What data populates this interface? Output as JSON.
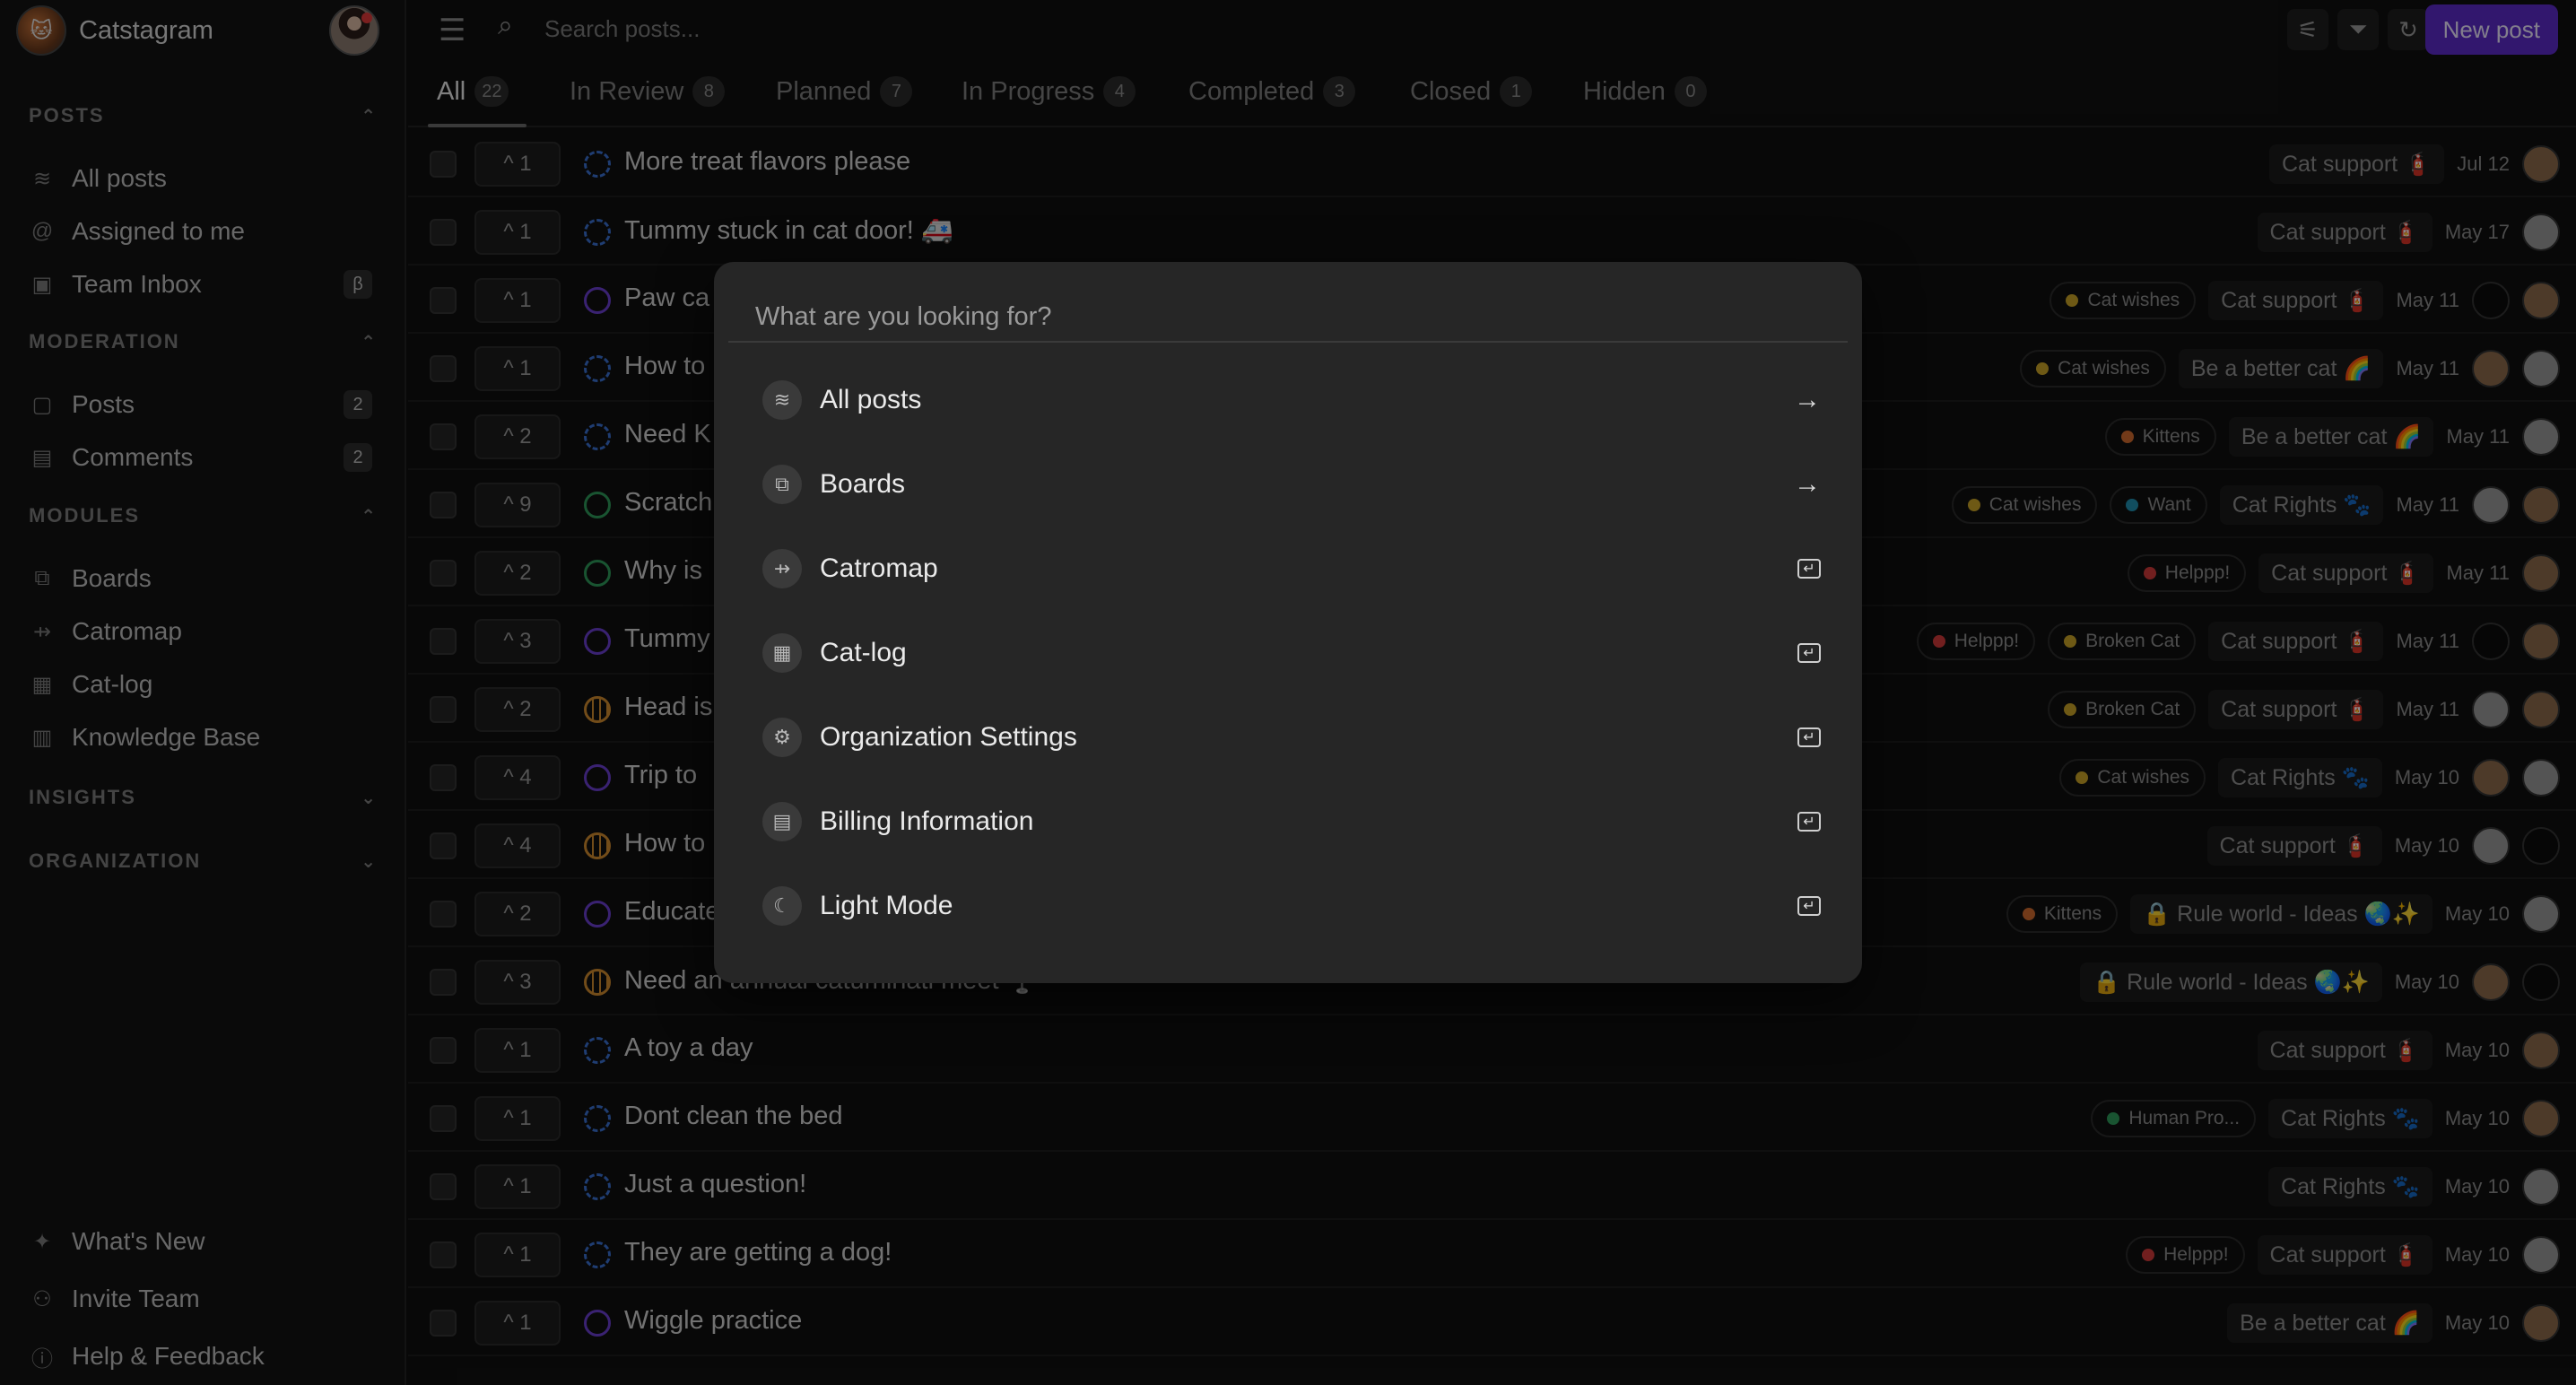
{
  "sidebar": {
    "brand": {
      "name": "Catstagram"
    },
    "sections": [
      {
        "title": "POSTS",
        "chevron": "⌃",
        "items": [
          {
            "label": "All posts",
            "icon": "rss-icon",
            "glyph": "≋"
          },
          {
            "label": "Assigned to me",
            "icon": "at-icon",
            "glyph": "@"
          },
          {
            "label": "Team Inbox",
            "icon": "inbox-icon",
            "glyph": "▣",
            "badge": "β"
          }
        ]
      },
      {
        "title": "MODERATION",
        "chevron": "⌃",
        "items": [
          {
            "label": "Posts",
            "icon": "posts-icon",
            "glyph": "▢",
            "badge": "2"
          },
          {
            "label": "Comments",
            "icon": "comments-icon",
            "glyph": "▤",
            "badge": "2"
          }
        ]
      },
      {
        "title": "MODULES",
        "chevron": "⌃",
        "items": [
          {
            "label": "Boards",
            "icon": "boards-icon",
            "glyph": "⧉"
          },
          {
            "label": "Catromap",
            "icon": "signpost-icon",
            "glyph": "⇸"
          },
          {
            "label": "Cat-log",
            "icon": "gift-icon",
            "glyph": "▦"
          },
          {
            "label": "Knowledge Base",
            "icon": "book-icon",
            "glyph": "▥"
          }
        ]
      },
      {
        "title": "INSIGHTS",
        "chevron": "⌄",
        "items": []
      },
      {
        "title": "ORGANIZATION",
        "chevron": "⌄",
        "items": []
      }
    ],
    "footer": [
      {
        "label": "What's New",
        "icon": "party-icon",
        "glyph": "✦"
      },
      {
        "label": "Invite Team",
        "icon": "user-plus-icon",
        "glyph": "⚇"
      },
      {
        "label": "Help & Feedback",
        "icon": "info-icon",
        "glyph": "ⓘ"
      }
    ]
  },
  "topbar": {
    "search_placeholder": "Search posts...",
    "new_post_label": "New post"
  },
  "tabs": [
    {
      "label": "All",
      "count": "22",
      "active": true
    },
    {
      "label": "In Review",
      "count": "8"
    },
    {
      "label": "Planned",
      "count": "7"
    },
    {
      "label": "In Progress",
      "count": "4"
    },
    {
      "label": "Completed",
      "count": "3"
    },
    {
      "label": "Closed",
      "count": "1"
    },
    {
      "label": "Hidden",
      "count": "0"
    }
  ],
  "posts": [
    {
      "votes": "^ 1",
      "status": "review",
      "title": "More treat flavors please",
      "tags": [],
      "board": "Cat support 🧯",
      "date": "Jul 12",
      "avatars": [
        "brown"
      ]
    },
    {
      "votes": "^ 1",
      "status": "review",
      "title": "Tummy stuck in cat door! 🚑",
      "tags": [],
      "board": "Cat support 🧯",
      "date": "May 17",
      "avatars": [
        "gray"
      ]
    },
    {
      "votes": "^ 1",
      "status": "planned",
      "title": "Paw ca",
      "tags": [
        {
          "label": "Cat wishes",
          "color": "#c9a227"
        }
      ],
      "board": "Cat support 🧯",
      "date": "May 11",
      "avatars": [
        "dark",
        "brown"
      ]
    },
    {
      "votes": "^ 1",
      "status": "review",
      "title": "How to",
      "tags": [
        {
          "label": "Cat wishes",
          "color": "#c9a227"
        }
      ],
      "board": "Be a better cat 🌈",
      "date": "May 11",
      "avatars": [
        "brown",
        "gray"
      ]
    },
    {
      "votes": "^ 2",
      "status": "review",
      "title": "Need K",
      "tags": [
        {
          "label": "Kittens",
          "color": "#d06a2e"
        }
      ],
      "board": "Be a better cat 🌈",
      "date": "May 11",
      "avatars": [
        "gray"
      ]
    },
    {
      "votes": "^ 9",
      "status": "done",
      "title": "Scratch",
      "tags": [
        {
          "label": "Cat wishes",
          "color": "#c9a227"
        },
        {
          "label": "Want",
          "color": "#1f8fb0"
        }
      ],
      "board": "Cat Rights 🐾",
      "date": "May 11",
      "avatars": [
        "gray",
        "brown"
      ]
    },
    {
      "votes": "^ 2",
      "status": "done",
      "title": "Why is",
      "tags": [
        {
          "label": "Helppp!",
          "color": "#d03a3a"
        }
      ],
      "board": "Cat support 🧯",
      "date": "May 11",
      "avatars": [
        "brown"
      ]
    },
    {
      "votes": "^ 3",
      "status": "planned",
      "title": "Tummy",
      "tags": [
        {
          "label": "Helppp!",
          "color": "#d03a3a"
        },
        {
          "label": "Broken Cat",
          "color": "#c9a227"
        }
      ],
      "board": "Cat support 🧯",
      "date": "May 11",
      "avatars": [
        "dark",
        "brown"
      ]
    },
    {
      "votes": "^ 2",
      "status": "progress",
      "title": "Head is",
      "tags": [
        {
          "label": "Broken Cat",
          "color": "#c9a227"
        }
      ],
      "board": "Cat support 🧯",
      "date": "May 11",
      "avatars": [
        "gray",
        "brown"
      ]
    },
    {
      "votes": "^ 4",
      "status": "planned",
      "title": "Trip to",
      "tags": [
        {
          "label": "Cat wishes",
          "color": "#c9a227"
        }
      ],
      "board": "Cat Rights 🐾",
      "date": "May 10",
      "avatars": [
        "brown",
        "gray"
      ]
    },
    {
      "votes": "^ 4",
      "status": "progress",
      "title": "How to",
      "tags": [],
      "board": "Cat support 🧯",
      "date": "May 10",
      "avatars": [
        "gray",
        "dark"
      ]
    },
    {
      "votes": "^ 2",
      "status": "planned",
      "title": "Educate",
      "tags": [
        {
          "label": "Kittens",
          "color": "#d06a2e"
        }
      ],
      "board": "🔒 Rule world - Ideas 🌏✨",
      "date": "May 10",
      "avatars": [
        "gray"
      ]
    },
    {
      "votes": "^ 3",
      "status": "progress",
      "title": "Need an annual catuminati meet 🍷",
      "tags": [],
      "board": "🔒 Rule world - Ideas 🌏✨",
      "date": "May 10",
      "avatars": [
        "brown",
        "dark"
      ]
    },
    {
      "votes": "^ 1",
      "status": "review",
      "title": "A toy a day",
      "tags": [],
      "board": "Cat support 🧯",
      "date": "May 10",
      "avatars": [
        "brown"
      ]
    },
    {
      "votes": "^ 1",
      "status": "review",
      "title": "Dont clean the bed",
      "tags": [
        {
          "label": "Human Pro...",
          "color": "#2e9a5a"
        }
      ],
      "board": "Cat Rights 🐾",
      "date": "May 10",
      "avatars": [
        "brown"
      ]
    },
    {
      "votes": "^ 1",
      "status": "review",
      "title": "Just a question!",
      "tags": [],
      "board": "Cat Rights 🐾",
      "date": "May 10",
      "avatars": [
        "gray"
      ]
    },
    {
      "votes": "^ 1",
      "status": "review",
      "title": "They are getting a dog!",
      "tags": [
        {
          "label": "Helppp!",
          "color": "#d03a3a"
        }
      ],
      "board": "Cat support 🧯",
      "date": "May 10",
      "avatars": [
        "gray"
      ]
    },
    {
      "votes": "^ 1",
      "status": "planned",
      "title": "Wiggle practice",
      "tags": [],
      "board": "Be a better cat 🌈",
      "date": "May 10",
      "avatars": [
        "brown"
      ]
    }
  ],
  "palette": {
    "placeholder": "What are you looking for?",
    "items": [
      {
        "label": "All posts",
        "icon": "rss-icon",
        "glyph": "≋",
        "action": "arrow"
      },
      {
        "label": "Boards",
        "icon": "boards-icon",
        "glyph": "⧉",
        "action": "arrow"
      },
      {
        "label": "Catromap",
        "icon": "signpost-icon",
        "glyph": "⇸",
        "action": "enter"
      },
      {
        "label": "Cat-log",
        "icon": "gift-icon",
        "glyph": "▦",
        "action": "enter"
      },
      {
        "label": "Organization Settings",
        "icon": "gear-icon",
        "glyph": "⚙",
        "action": "enter"
      },
      {
        "label": "Billing Information",
        "icon": "receipt-icon",
        "glyph": "▤",
        "action": "enter"
      },
      {
        "label": "Light Mode",
        "icon": "moon-icon",
        "glyph": "☾",
        "action": "enter"
      }
    ]
  }
}
